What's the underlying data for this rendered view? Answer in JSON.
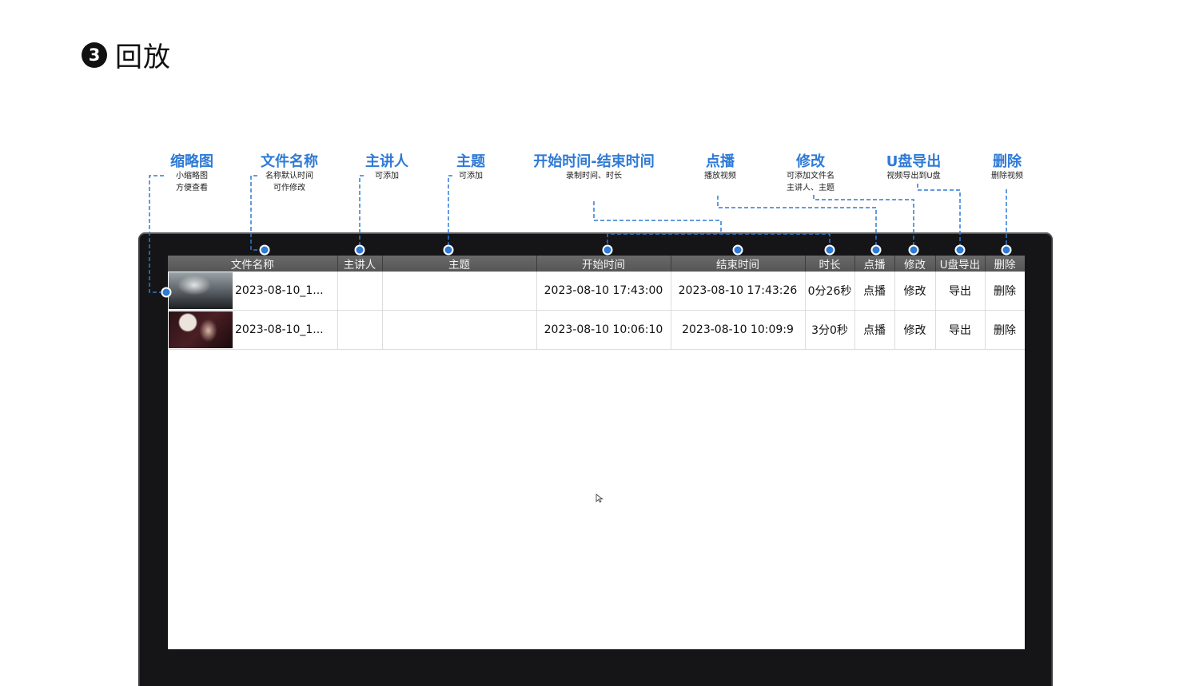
{
  "heading": {
    "step": "3",
    "title": "回放"
  },
  "callouts": [
    {
      "title": "缩略图",
      "lines": [
        "小缩略图",
        "方便查看"
      ]
    },
    {
      "title": "文件名称",
      "lines": [
        "名称默认时间",
        "可作修改"
      ]
    },
    {
      "title": "主讲人",
      "lines": [
        "可添加"
      ]
    },
    {
      "title": "主题",
      "lines": [
        "可添加"
      ]
    },
    {
      "title": "开始时间-结束时间",
      "lines": [
        "录制时间、时长"
      ]
    },
    {
      "title": "点播",
      "lines": [
        "播放视频"
      ]
    },
    {
      "title": "修改",
      "lines": [
        "可添加文件名",
        "主讲人、主题"
      ]
    },
    {
      "title": "U盘导出",
      "lines": [
        "视频导出到U盘"
      ]
    },
    {
      "title": "删除",
      "lines": [
        "删除视频"
      ]
    }
  ],
  "table": {
    "columns": [
      "文件名称",
      "主讲人",
      "主题",
      "开始时间",
      "结束时间",
      "时长",
      "点播",
      "修改",
      "U盘导出",
      "删除"
    ],
    "rows": [
      {
        "name": "2023-08-10_1...",
        "speaker": "",
        "topic": "",
        "start": "2023-08-10 17:43:00",
        "end": "2023-08-10 17:43:26",
        "duration": "0分26秒",
        "play": "点播",
        "edit": "修改",
        "export": "导出",
        "delete": "删除"
      },
      {
        "name": "2023-08-10_1...",
        "speaker": "",
        "topic": "",
        "start": "2023-08-10 10:06:10",
        "end": "2023-08-10 10:09:9",
        "duration": "3分0秒",
        "play": "点播",
        "edit": "修改",
        "export": "导出",
        "delete": "删除"
      }
    ]
  },
  "colors": {
    "accent": "#2e7ad6",
    "header_bg": "#5f5f5f",
    "bezel": "#151517"
  },
  "icons": {
    "pointer": "mouse-pointer-icon"
  }
}
